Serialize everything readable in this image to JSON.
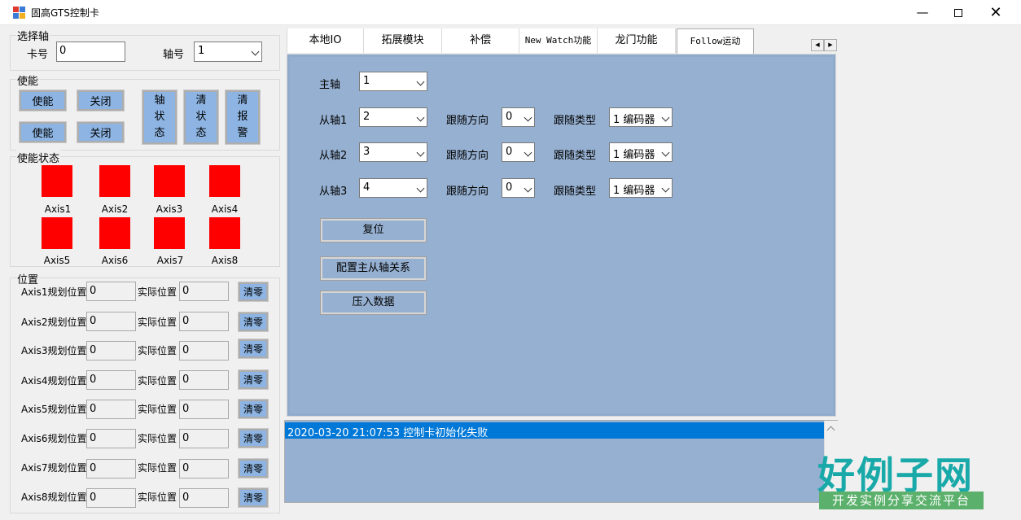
{
  "window": {
    "title": "固高GTS控制卡"
  },
  "select_axis": {
    "group_title": "选择轴",
    "card_label": "卡号",
    "card_value": "0",
    "axis_label": "轴号",
    "axis_value": "1"
  },
  "enable": {
    "group_title": "使能",
    "enable_btn_1": "使能",
    "close_btn_1": "关闭",
    "enable_btn_2": "使能",
    "close_btn_2": "关闭",
    "axis_status_btn": [
      "轴",
      "状",
      "态"
    ],
    "clear_status_btn": [
      "清",
      "状",
      "态"
    ],
    "clear_alarm_btn": [
      "清",
      "报",
      "警"
    ]
  },
  "enable_status": {
    "group_title": "使能状态",
    "axes": [
      "Axis1",
      "Axis2",
      "Axis3",
      "Axis4",
      "Axis5",
      "Axis6",
      "Axis7",
      "Axis8"
    ],
    "led_color": "#ff0000"
  },
  "position": {
    "group_title": "位置",
    "rows": [
      {
        "plan_label": "Axis1规划位置",
        "plan_value": "0",
        "actual_label": "实际位置",
        "actual_value": "0",
        "clear_btn": "清零"
      },
      {
        "plan_label": "Axis2规划位置",
        "plan_value": "0",
        "actual_label": "实际位置",
        "actual_value": "0",
        "clear_btn": "清零"
      },
      {
        "plan_label": "Axis3规划位置",
        "plan_value": "0",
        "actual_label": "实际位置",
        "actual_value": "0",
        "clear_btn": "清零"
      },
      {
        "plan_label": "Axis4规划位置",
        "plan_value": "0",
        "actual_label": "实际位置",
        "actual_value": "0",
        "clear_btn": "清零"
      },
      {
        "plan_label": "Axis5规划位置",
        "plan_value": "0",
        "actual_label": "实际位置",
        "actual_value": "0",
        "clear_btn": "清零"
      },
      {
        "plan_label": "Axis6规划位置",
        "plan_value": "0",
        "actual_label": "实际位置",
        "actual_value": "0",
        "clear_btn": "清零"
      },
      {
        "plan_label": "Axis7规划位置",
        "plan_value": "0",
        "actual_label": "实际位置",
        "actual_value": "0",
        "clear_btn": "清零"
      },
      {
        "plan_label": "Axis8规划位置",
        "plan_value": "0",
        "actual_label": "实际位置",
        "actual_value": "0",
        "clear_btn": "清零"
      }
    ]
  },
  "tabs": [
    "本地IO",
    "拓展模块",
    "补偿",
    "New Watch功能",
    "龙门功能",
    "Follow运动"
  ],
  "active_tab": "Follow运动",
  "follow": {
    "master_label": "主轴",
    "master_value": "1",
    "slaves": [
      {
        "label": "从轴1",
        "value": "2",
        "dir_label": "跟随方向",
        "dir_value": "0",
        "type_label": "跟随类型",
        "type_value": "1 编码器"
      },
      {
        "label": "从轴2",
        "value": "3",
        "dir_label": "跟随方向",
        "dir_value": "0",
        "type_label": "跟随类型",
        "type_value": "1 编码器"
      },
      {
        "label": "从轴3",
        "value": "4",
        "dir_label": "跟随方向",
        "dir_value": "0",
        "type_label": "跟随类型",
        "type_value": "1 编码器"
      }
    ],
    "reset_btn": "复位",
    "config_btn": "配置主从轴关系",
    "push_btn": "压入数据"
  },
  "log": {
    "lines": [
      "2020-03-20 21:07:53 控制卡初始化失败"
    ]
  },
  "watermark": {
    "logo": "好例子网",
    "slogan": "开发实例分享交流平台"
  },
  "colors": {
    "button_blue": "#8db4e2",
    "panel_blue": "#96b0d1",
    "selection": "#0078d7",
    "led_red": "#ff0000"
  }
}
